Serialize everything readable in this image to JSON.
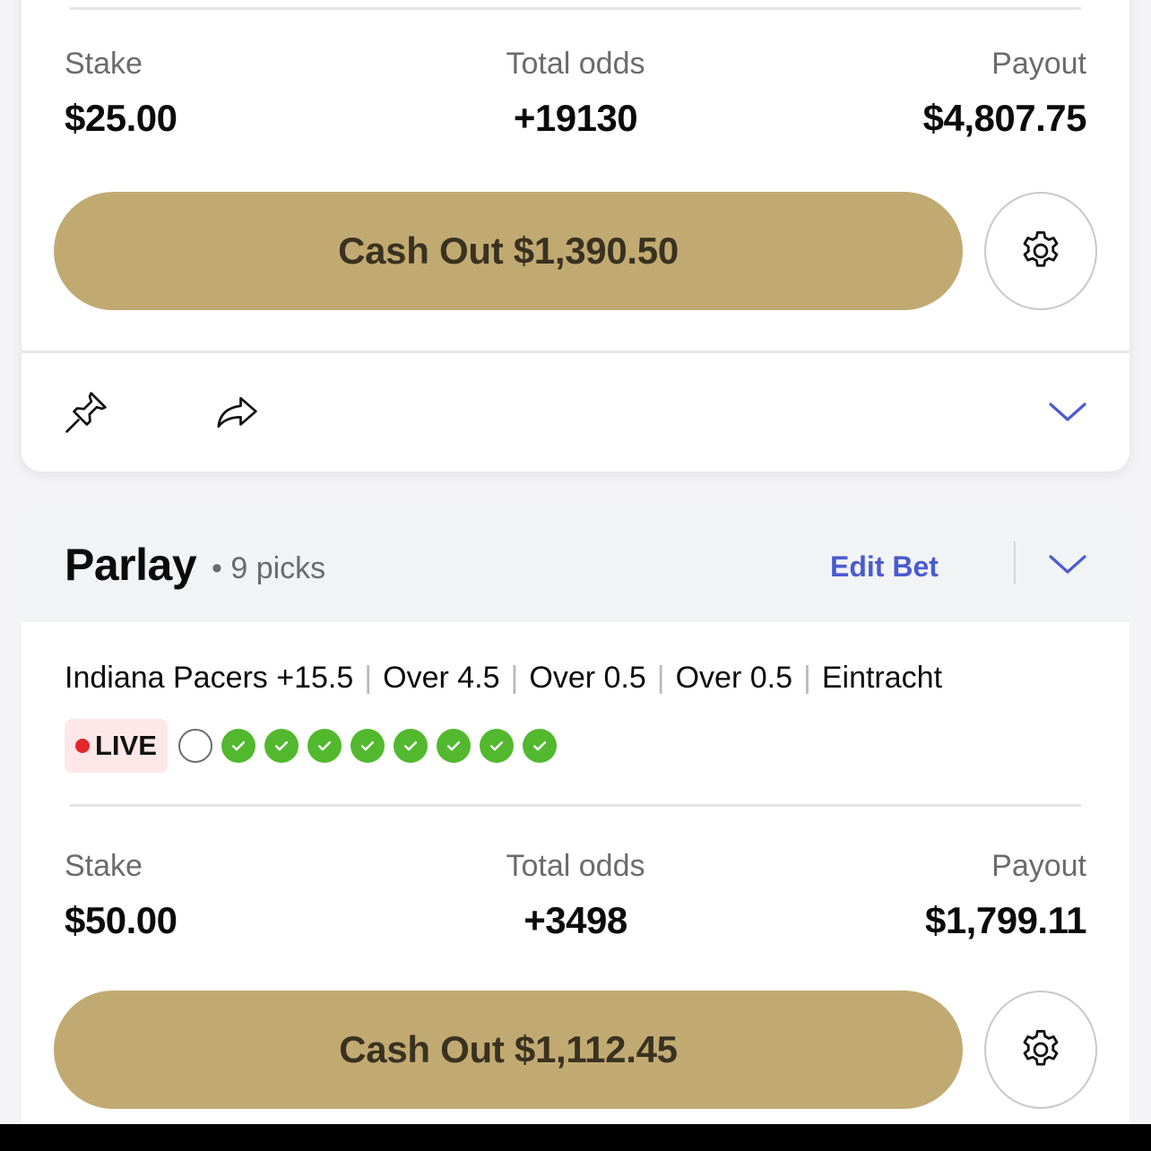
{
  "bet1": {
    "stake_label": "Stake",
    "stake_value": "$25.00",
    "odds_label": "Total odds",
    "odds_value": "+19130",
    "payout_label": "Payout",
    "payout_value": "$4,807.75",
    "cashout_label": "Cash Out $1,390.50",
    "icons": [
      "gear-icon",
      "pin-icon",
      "share-icon",
      "chevron-down-icon"
    ]
  },
  "bet2": {
    "title": "Parlay",
    "subtitle": "• 9 picks",
    "edit_label": "Edit Bet",
    "legs": [
      "Indiana Pacers +15.5",
      "Over 4.5",
      "Over 0.5",
      "Over 0.5",
      "Eintracht"
    ],
    "live_label": "LIVE",
    "picks": [
      "pending",
      "won",
      "won",
      "won",
      "won",
      "won",
      "won",
      "won",
      "won"
    ],
    "stake_label": "Stake",
    "stake_value": "$50.00",
    "odds_label": "Total odds",
    "odds_value": "+3498",
    "payout_label": "Payout",
    "payout_value": "$1,799.11",
    "cashout_label": "Cash Out $1,112.45",
    "icons": [
      "chevron-down-icon",
      "gear-icon",
      "check-icon"
    ]
  },
  "colors": {
    "cashout_bg": "#c1aa72",
    "accent_blue": "#4a5bd0",
    "live_red": "#e3262c",
    "won_green": "#52b82e"
  }
}
